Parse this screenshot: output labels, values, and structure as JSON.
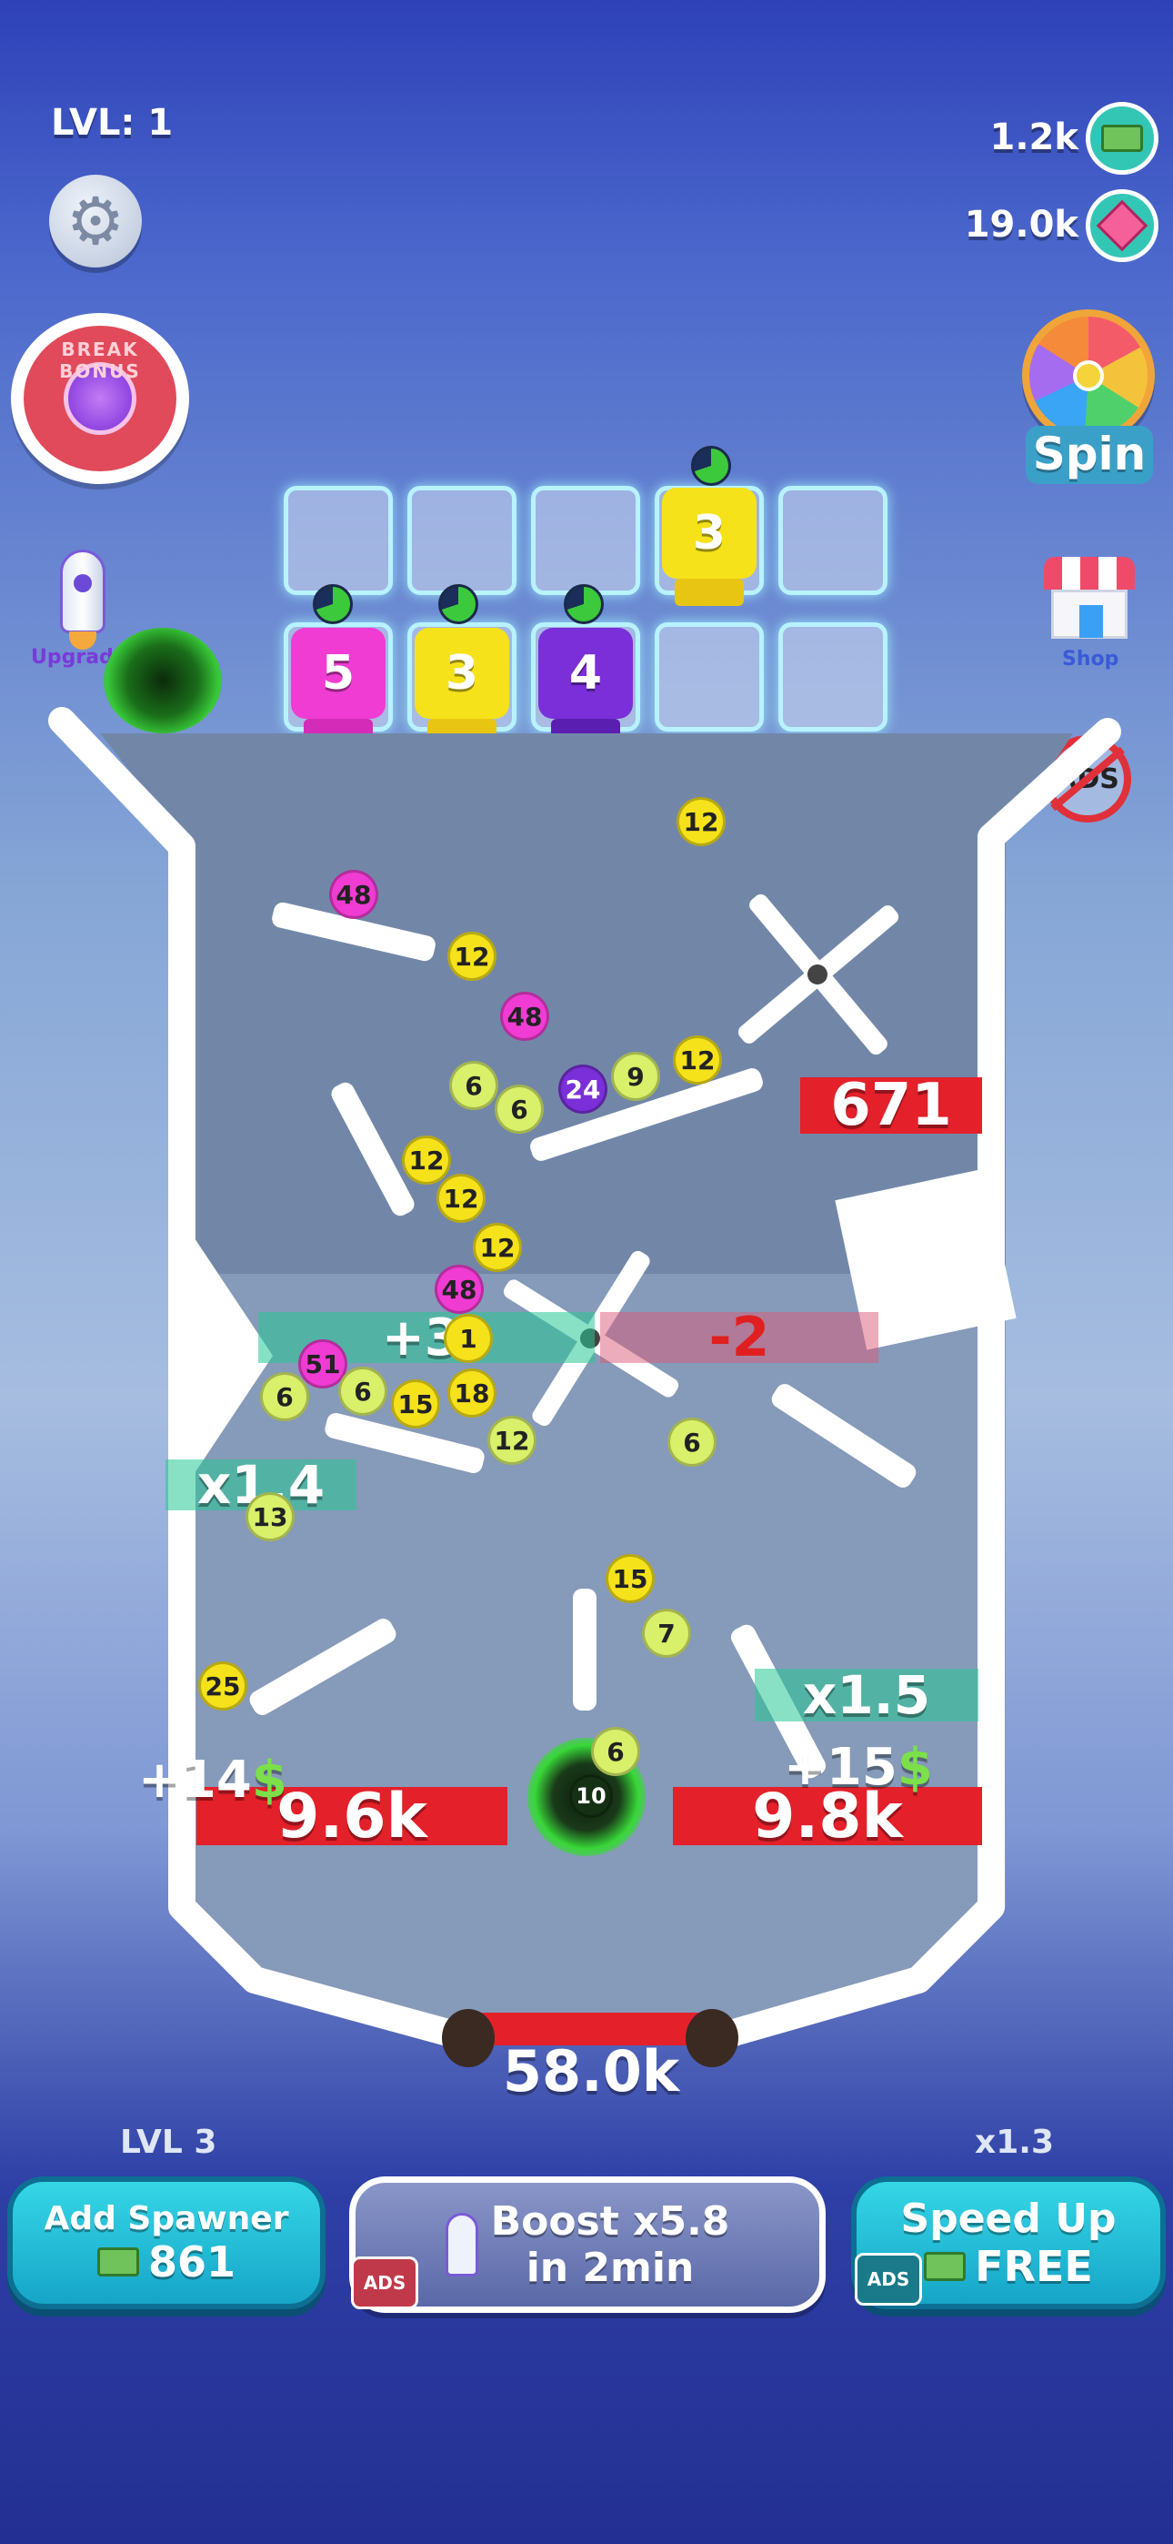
{
  "hud": {
    "level": "LVL: 1",
    "cash": "1.2k",
    "gems": "19.0k",
    "spin_label": "Spin",
    "upgrade_label": "Upgrade",
    "shop_label": "Shop",
    "no_ads_label": "ADS",
    "break_bonus_label": "BREAK BONUS"
  },
  "spawners": {
    "top_row": [
      {
        "value": ""
      },
      {
        "value": ""
      },
      {
        "value": ""
      },
      {
        "value": "3",
        "color": "#f5e21a"
      },
      {
        "value": ""
      }
    ],
    "bottom_row": [
      {
        "value": "5",
        "color": "#f03cd2"
      },
      {
        "value": "3",
        "color": "#f5e21a"
      },
      {
        "value": "4",
        "color": "#7a2fd8"
      },
      {
        "value": ""
      },
      {
        "value": ""
      }
    ]
  },
  "board": {
    "top_block_value": "671",
    "minus_zone": "-2",
    "plus_zone": "+3",
    "mult_left": "x1.4",
    "mult_right": "x1.5",
    "left_pocket": "9.6k",
    "right_pocket": "9.8k",
    "bottom_bar": "58.0k",
    "float_left": "+14",
    "float_right": "+15",
    "currency_symbol": "$"
  },
  "balls": [
    {
      "n": "12",
      "c": "#f5e21a"
    },
    {
      "n": "48",
      "c": "#f03cd2"
    },
    {
      "n": "12",
      "c": "#f5e21a"
    },
    {
      "n": "48",
      "c": "#f03cd2"
    },
    {
      "n": "6",
      "c": "#d8f06a"
    },
    {
      "n": "6",
      "c": "#d8f06a"
    },
    {
      "n": "24",
      "c": "#7a2fd8"
    },
    {
      "n": "9",
      "c": "#d8f06a"
    },
    {
      "n": "12",
      "c": "#f5e21a"
    },
    {
      "n": "12",
      "c": "#f5e21a"
    },
    {
      "n": "12",
      "c": "#f5e21a"
    },
    {
      "n": "12",
      "c": "#f5e21a"
    },
    {
      "n": "48",
      "c": "#f03cd2"
    },
    {
      "n": "1",
      "c": "#f5e21a"
    },
    {
      "n": "51",
      "c": "#f03cd2"
    },
    {
      "n": "6",
      "c": "#d8f06a"
    },
    {
      "n": "6",
      "c": "#d8f06a"
    },
    {
      "n": "15",
      "c": "#f5e21a"
    },
    {
      "n": "18",
      "c": "#f5e21a"
    },
    {
      "n": "12",
      "c": "#d8f06a"
    },
    {
      "n": "6",
      "c": "#d8f06a"
    },
    {
      "n": "13",
      "c": "#d8f06a"
    },
    {
      "n": "15",
      "c": "#f5e21a"
    },
    {
      "n": "7",
      "c": "#d8f06a"
    },
    {
      "n": "25",
      "c": "#f5e21a"
    },
    {
      "n": "6",
      "c": "#d8f06a"
    },
    {
      "n": "10",
      "c": "#d8f06a"
    }
  ],
  "bottom": {
    "spawner_level": "LVL 3",
    "add_spawner_label": "Add Spawner",
    "add_spawner_cost": "861",
    "boost_line1": "Boost x5.8",
    "boost_line2": "in 2min",
    "boost_ads": "ADS",
    "speed_mult": "x1.3",
    "speed_label": "Speed Up",
    "speed_cost": "FREE",
    "speed_ads": "ADS"
  }
}
